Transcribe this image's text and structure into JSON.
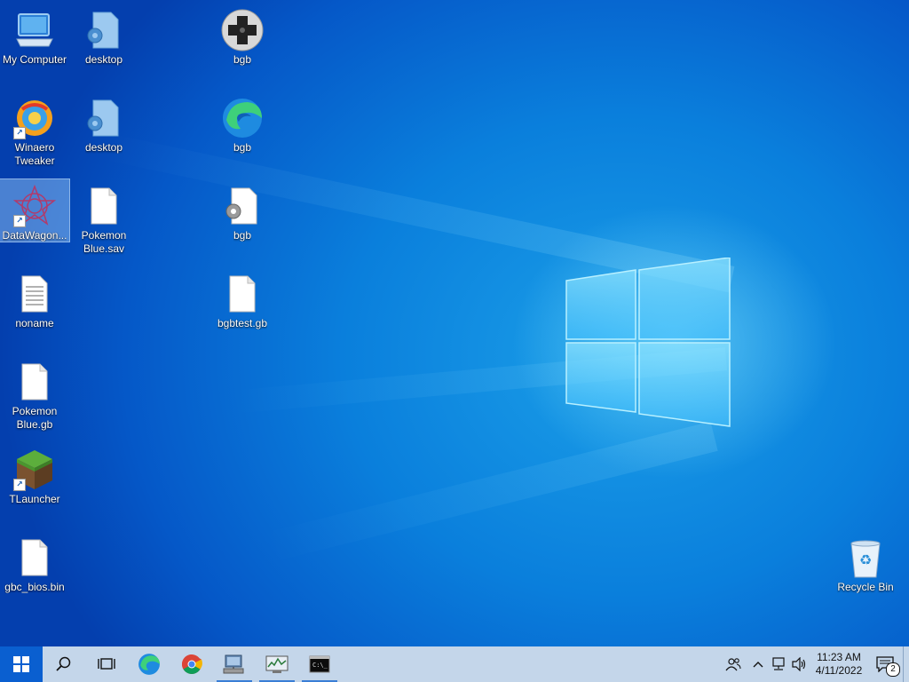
{
  "desktop_icons": [
    {
      "name": "my-computer-icon",
      "label": "My Computer",
      "icon": "computer"
    },
    {
      "name": "desktop-file-1",
      "label": "desktop",
      "icon": "settings-file"
    },
    {
      "name": "bgb-gamepad",
      "label": "bgb",
      "icon": "gamepad"
    },
    {
      "name": "winaero-tweaker",
      "label": "Winaero\nTweaker",
      "icon": "winaero-shortcut"
    },
    {
      "name": "desktop-file-2",
      "label": "desktop",
      "icon": "settings-file"
    },
    {
      "name": "bgb-edge",
      "label": "bgb",
      "icon": "edge"
    },
    {
      "name": "datawagon",
      "label": "DataWagon...",
      "icon": "datawagon-shortcut",
      "selected": true
    },
    {
      "name": "pokemon-blue-sav",
      "label": "Pokemon\nBlue.sav",
      "icon": "blank-file"
    },
    {
      "name": "bgb-settings",
      "label": "bgb",
      "icon": "settings-file"
    },
    {
      "name": "noname",
      "label": "noname",
      "icon": "text-file"
    },
    {
      "name": "bgbtest-gb",
      "label": "bgbtest.gb",
      "icon": "blank-file"
    },
    {
      "name": "pokemon-blue-gb",
      "label": "Pokemon\nBlue.gb",
      "icon": "blank-file"
    },
    {
      "name": "tlauncher",
      "label": "TLauncher",
      "icon": "minecraft-shortcut"
    },
    {
      "name": "gbc-bios-bin",
      "label": "gbc_bios.bin",
      "icon": "blank-file"
    },
    {
      "name": "recycle-bin",
      "label": "Recycle Bin",
      "icon": "recycle-bin"
    }
  ],
  "taskbar": {
    "apps": [
      {
        "name": "edge",
        "icon": "edge-icon",
        "running": false
      },
      {
        "name": "chrome",
        "icon": "chrome-icon",
        "running": false
      },
      {
        "name": "network-app",
        "icon": "network-computer-icon",
        "running": true
      },
      {
        "name": "monitor-app",
        "icon": "performance-monitor-icon",
        "running": true
      },
      {
        "name": "cmd",
        "icon": "command-prompt-icon",
        "running": true
      }
    ],
    "clock_time": "11:23 AM",
    "clock_date": "4/11/2022",
    "notification_count": "2"
  },
  "colors": {
    "taskbar_bg": "#c4d6ea",
    "desktop_accent": "#0a7fdc"
  }
}
